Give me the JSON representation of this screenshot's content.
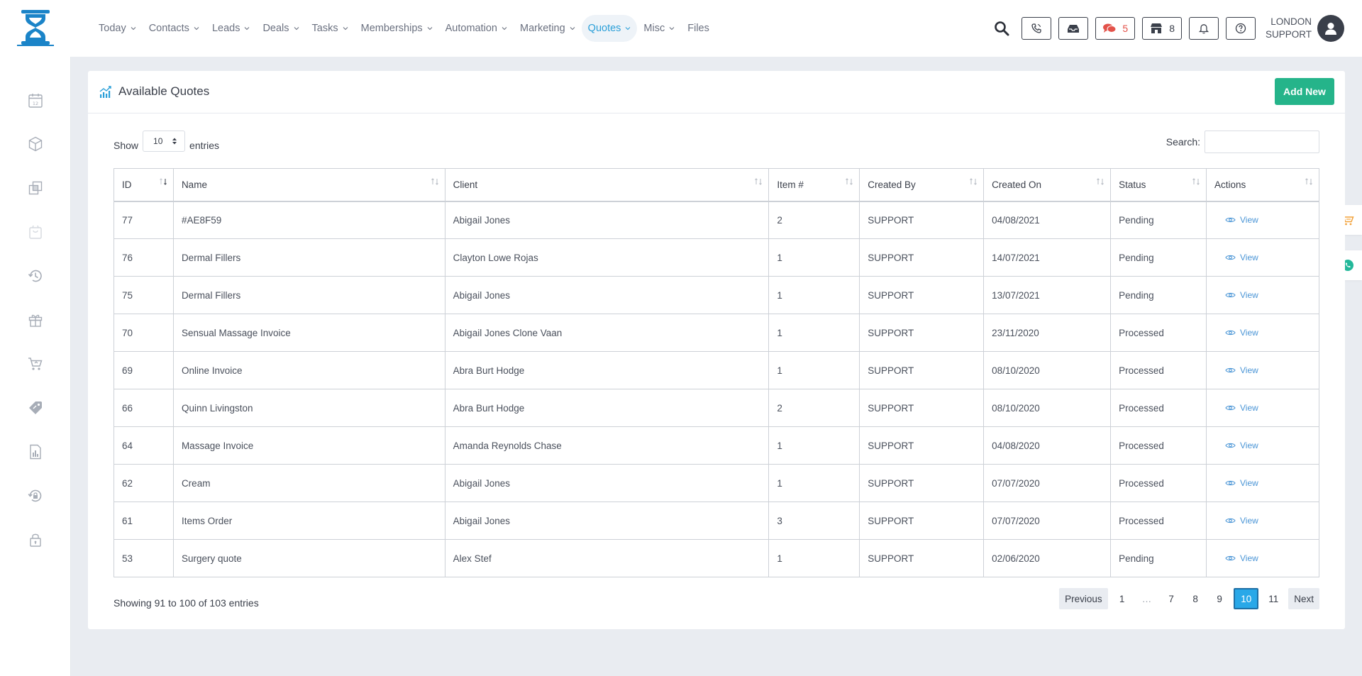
{
  "nav": {
    "items": [
      {
        "label": "Today",
        "dropdown": true
      },
      {
        "label": "Contacts",
        "dropdown": true
      },
      {
        "label": "Leads",
        "dropdown": true
      },
      {
        "label": "Deals",
        "dropdown": true
      },
      {
        "label": "Tasks",
        "dropdown": true
      },
      {
        "label": "Memberships",
        "dropdown": true
      },
      {
        "label": "Automation",
        "dropdown": true
      },
      {
        "label": "Marketing",
        "dropdown": true
      },
      {
        "label": "Quotes",
        "dropdown": true
      },
      {
        "label": "Misc",
        "dropdown": true
      },
      {
        "label": "Files",
        "dropdown": false
      }
    ],
    "active": "Quotes"
  },
  "topbar": {
    "messages_count": "5",
    "store_count": "8",
    "user_line1": "LONDON",
    "user_line2": "SUPPORT"
  },
  "sidebar": {
    "icons": [
      "calendar-icon",
      "box-icon",
      "layers-icon",
      "bag-icon",
      "history-icon",
      "gift-icon",
      "cart-icon",
      "tag-icon",
      "report-icon",
      "lock-circle-icon",
      "padlock-icon"
    ]
  },
  "card": {
    "title": "Available Quotes",
    "add_label": "Add New",
    "show_label": "Show",
    "entries_label": "entries",
    "page_size": "10",
    "search_label": "Search:"
  },
  "table": {
    "columns": [
      "ID",
      "Name",
      "Client",
      "Item #",
      "Created By",
      "Created On",
      "Status",
      "Actions"
    ],
    "view_label": "View",
    "rows": [
      {
        "id": "77",
        "name": "#AE8F59",
        "client": "Abigail Jones",
        "items": "2",
        "created_by": "SUPPORT",
        "created_on": "04/08/2021",
        "status": "Pending"
      },
      {
        "id": "76",
        "name": "Dermal Fillers",
        "client": "Clayton Lowe Rojas",
        "items": "1",
        "created_by": "SUPPORT",
        "created_on": "14/07/2021",
        "status": "Pending"
      },
      {
        "id": "75",
        "name": "Dermal Fillers",
        "client": "Abigail Jones",
        "items": "1",
        "created_by": "SUPPORT",
        "created_on": "13/07/2021",
        "status": "Pending"
      },
      {
        "id": "70",
        "name": "Sensual Massage Invoice",
        "client": "Abigail Jones Clone Vaan",
        "items": "1",
        "created_by": "SUPPORT",
        "created_on": "23/11/2020",
        "status": "Processed"
      },
      {
        "id": "69",
        "name": "Online Invoice",
        "client": "Abra Burt Hodge",
        "items": "1",
        "created_by": "SUPPORT",
        "created_on": "08/10/2020",
        "status": "Processed"
      },
      {
        "id": "66",
        "name": "Quinn Livingston",
        "client": "Abra Burt Hodge",
        "items": "2",
        "created_by": "SUPPORT",
        "created_on": "08/10/2020",
        "status": "Processed"
      },
      {
        "id": "64",
        "name": "Massage Invoice",
        "client": "Amanda Reynolds Chase",
        "items": "1",
        "created_by": "SUPPORT",
        "created_on": "04/08/2020",
        "status": "Processed"
      },
      {
        "id": "62",
        "name": "Cream",
        "client": "Abigail Jones",
        "items": "1",
        "created_by": "SUPPORT",
        "created_on": "07/07/2020",
        "status": "Processed"
      },
      {
        "id": "61",
        "name": "Items Order",
        "client": "Abigail Jones",
        "items": "3",
        "created_by": "SUPPORT",
        "created_on": "07/07/2020",
        "status": "Processed"
      },
      {
        "id": "53",
        "name": "Surgery quote",
        "client": "Alex Stef",
        "items": "1",
        "created_by": "SUPPORT",
        "created_on": "02/06/2020",
        "status": "Pending"
      }
    ]
  },
  "footer": {
    "info": "Showing 91 to 100 of 103 entries",
    "pages": [
      "Previous",
      "1",
      "…",
      "7",
      "8",
      "9",
      "10",
      "11",
      "Next"
    ],
    "active_page": "10"
  },
  "colors": {
    "accent": "#29a8e8",
    "add_button": "#25b48a",
    "alert_red": "#e3524a"
  }
}
